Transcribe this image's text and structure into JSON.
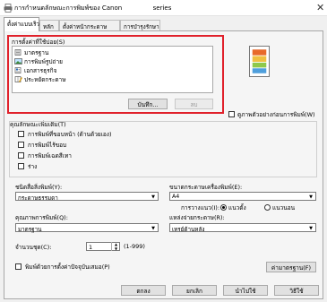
{
  "window": {
    "title": "การกำหนดลักษณะการพิมพ์ของ Canon",
    "title_tail": "series",
    "close_glyph": "✕"
  },
  "tabs": [
    {
      "label": "ตั้งค่าแบบเร็ว"
    },
    {
      "label": "หลัก"
    },
    {
      "label": "ตั้งค่าหน้ากระดาษ"
    },
    {
      "label": "การบำรุงรักษา"
    }
  ],
  "common_settings": {
    "label": "การตั้งค่าที่ใช้บ่อย(S)",
    "items": [
      {
        "label": "มาตรฐาน",
        "icon": "standard-print-icon",
        "selected": false
      },
      {
        "label": "การพิมพ์รูปถ่าย",
        "icon": "photo-print-icon",
        "selected": false
      },
      {
        "label": "เอกสารธุรกิจ",
        "icon": "business-document-icon",
        "selected": false
      },
      {
        "label": "ประหยัดกระดาษ",
        "icon": "paper-saving-icon",
        "selected": false
      }
    ],
    "save_label": "บันทึก...",
    "delete_label": "ลบ"
  },
  "preview": {
    "always_print_label": "ดูภาพตัวอย่างก่อนการพิมพ์(W)"
  },
  "additional_features": {
    "label": "คุณลักษณะเพิ่มเติม(T)",
    "items": [
      {
        "label": "การพิมพ์ที่ขอบหน้า (ด้านด้วยเอง)",
        "checked": false
      },
      {
        "label": "การพิมพ์ไร้ขอบ",
        "checked": false
      },
      {
        "label": "การพิมพ์เฉดสีเทา",
        "checked": false
      },
      {
        "label": "ร่าง",
        "checked": false
      }
    ]
  },
  "media_type": {
    "label": "ชนิดสื่อสิ่งพิมพ์(Y):",
    "value": "กระดาษธรรมดา"
  },
  "paper_size": {
    "label": "ขนาดกระดาษเครื่องพิมพ์(E):",
    "value": "A4"
  },
  "orientation": {
    "label": "การวางแนว(I):",
    "portrait_label": "แนวตั้ง",
    "landscape_label": "แนวนอน",
    "selected": "portrait"
  },
  "print_quality": {
    "label": "คุณภาพการพิมพ์(Q):",
    "value": "มาตรฐาน"
  },
  "paper_source": {
    "label": "แหล่งจ่ายกระดาษ(R):",
    "value": "เทรย์ด้านหลัง"
  },
  "copies": {
    "label": "จำนวนชุด(C):",
    "value": "1",
    "range": "(1-999)"
  },
  "always_show": {
    "label": "พิมพ์ด้วยการตั้งค่าปัจจุบันเสมอ(P)",
    "checked": false
  },
  "defaults_button": "ค่ามาตรฐาน(F)",
  "footer": {
    "ok": "ตกลง",
    "cancel": "ยกเลิก",
    "apply": "นำไปใช้",
    "help": "วิธีใช้"
  }
}
